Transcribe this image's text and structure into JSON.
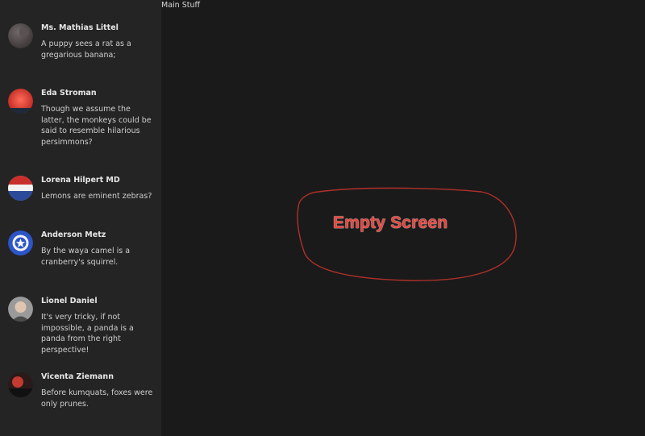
{
  "main": {
    "title": "Main Stuff",
    "annotation": "Empty Screen",
    "annotation_color": "#e8453c"
  },
  "sidebar": {
    "contacts": [
      {
        "name": "Ms. Mathias Littel",
        "message": "A puppy sees a rat as a gregarious banana;",
        "avatar_icon": "user-avatar-dark"
      },
      {
        "name": "Eda Stroman",
        "message": "Though we assume the latter, the monkeys could be said to resemble hilarious persimmons?",
        "avatar_icon": "user-avatar-red"
      },
      {
        "name": "Lorena Hilpert MD",
        "message": "Lemons are eminent zebras?",
        "avatar_icon": "user-avatar-flag"
      },
      {
        "name": "Anderson Metz",
        "message": "By the waya camel is a cranberry's squirrel.",
        "avatar_icon": "user-avatar-shield"
      },
      {
        "name": "Lionel Daniel",
        "message": "It's very tricky, if not impossible, a panda is a panda from the right perspective!",
        "avatar_icon": "user-avatar-face"
      },
      {
        "name": "Vicenta Ziemann",
        "message": "Before kumquats, foxes were only prunes.",
        "avatar_icon": "user-avatar-red-dark"
      }
    ]
  }
}
